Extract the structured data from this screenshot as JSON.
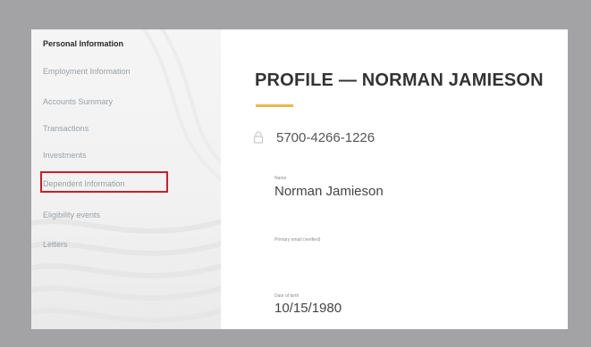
{
  "sidebar": {
    "items": [
      {
        "label": "Personal Information",
        "active": true
      },
      {
        "label": "Employment Information",
        "active": false
      },
      {
        "label": "Accounts Summary",
        "active": false
      },
      {
        "label": "Transactions",
        "active": false
      },
      {
        "label": "Investments",
        "active": false
      },
      {
        "label": "Dependent Information",
        "active": false,
        "highlighted": true
      },
      {
        "label": "Eligibility events",
        "active": false
      },
      {
        "label": "Letters",
        "active": false
      }
    ]
  },
  "profile": {
    "title": "PROFILE — NORMAN JAMIESON",
    "account_number": "5700-4266-1226",
    "name_label": "Name",
    "name_value": "Norman Jamieson",
    "email_label": "Primary email (verified)",
    "email_value": "",
    "dob_label": "Date of birth",
    "dob_value": "10/15/1980"
  },
  "colors": {
    "highlight": "#c8202a",
    "accent": "#e9b84a",
    "backdrop": "#a3a3a5"
  },
  "icons": {
    "account": "lock-icon"
  }
}
